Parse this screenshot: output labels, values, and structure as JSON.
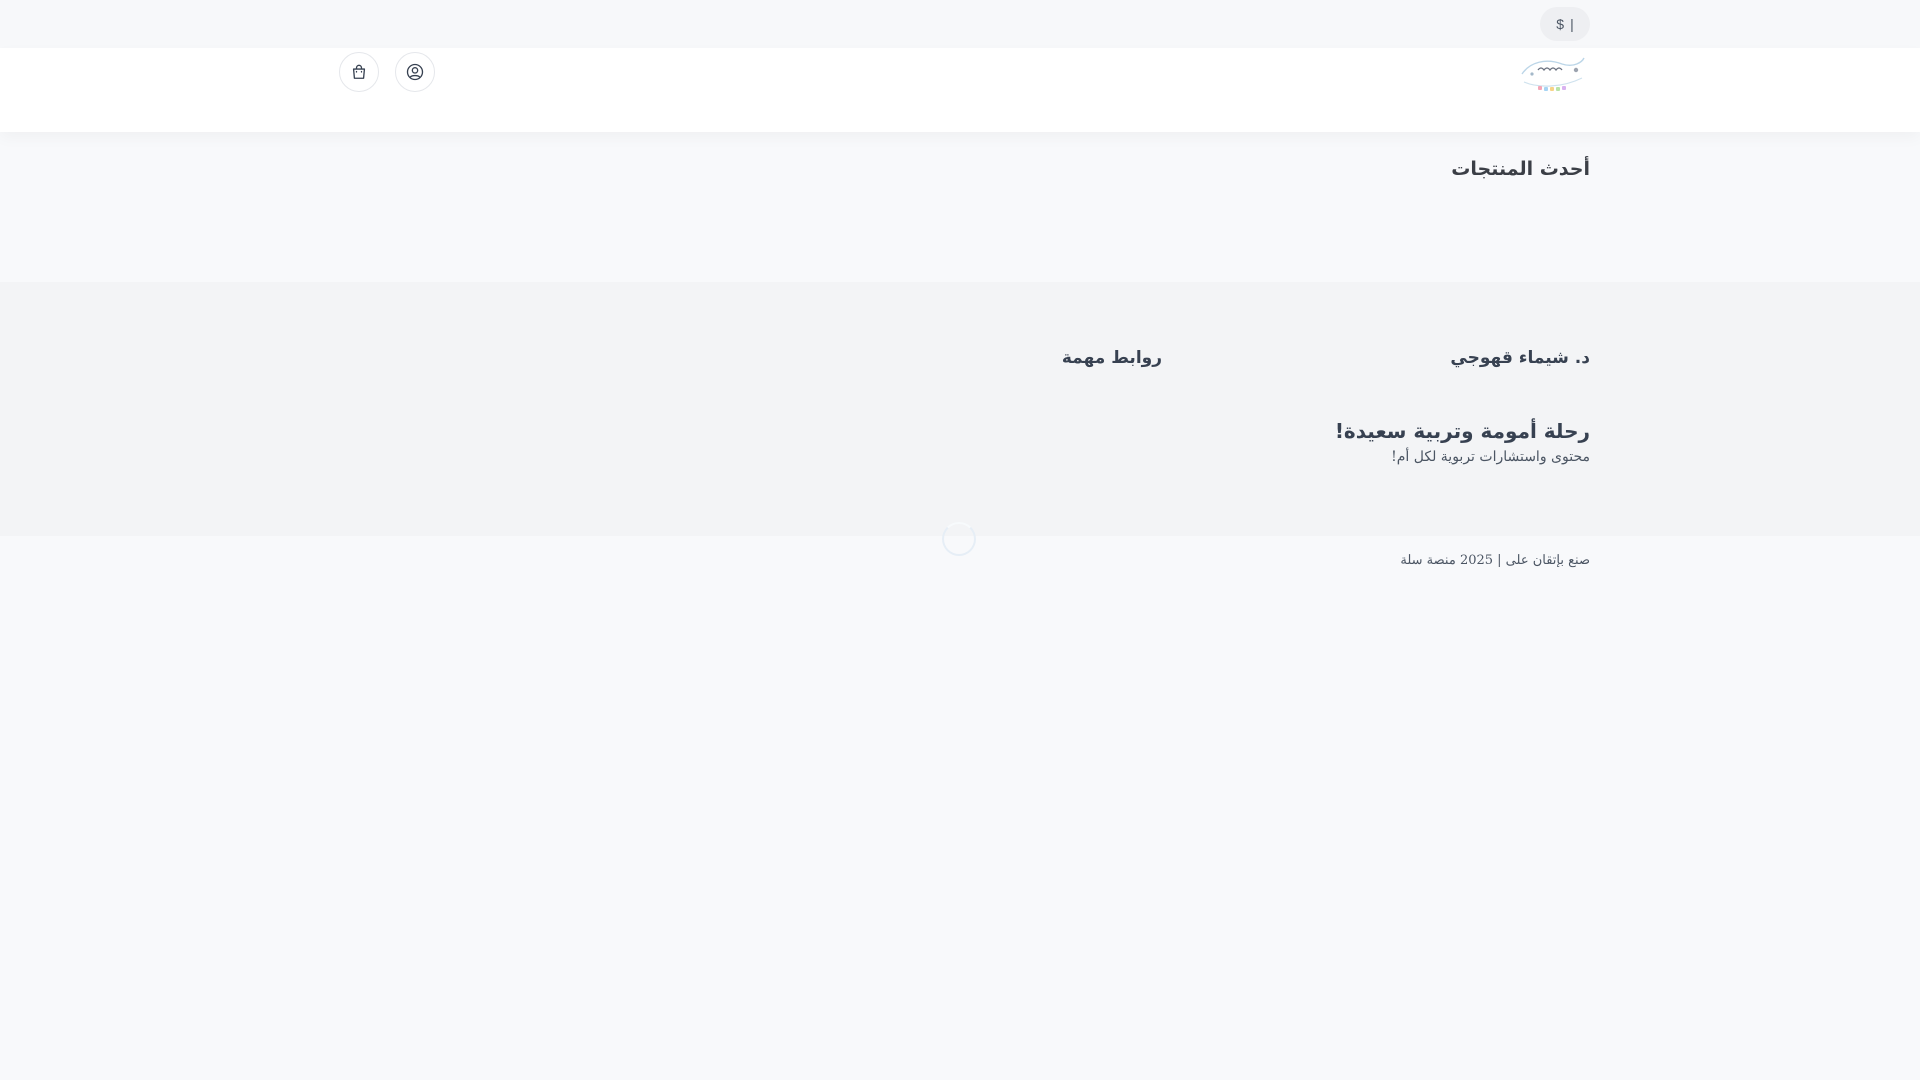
{
  "topbar": {
    "currency_symbol": "$",
    "separator": "|"
  },
  "header": {
    "logo_alt": "د. شيماء قهوجي",
    "icons": [
      "user-icon",
      "cart-icon"
    ]
  },
  "main": {
    "latest_products_title": "أحدث المنتجات"
  },
  "footer": {
    "brand": "د. شيماء قهوجي",
    "links_title": "روابط مهمة",
    "tagline": "رحلة أمومة وتربية سعيدة!",
    "description": "محتوى واستشارات تربوية لكل أم!",
    "copyright": "صنع بإتقان على | 2025 منصة سلة"
  },
  "colors": {
    "page_bg": "#f8f9fb",
    "header_bg": "#ffffff",
    "footer_bg": "#f3f4f6",
    "text": "#374151"
  }
}
